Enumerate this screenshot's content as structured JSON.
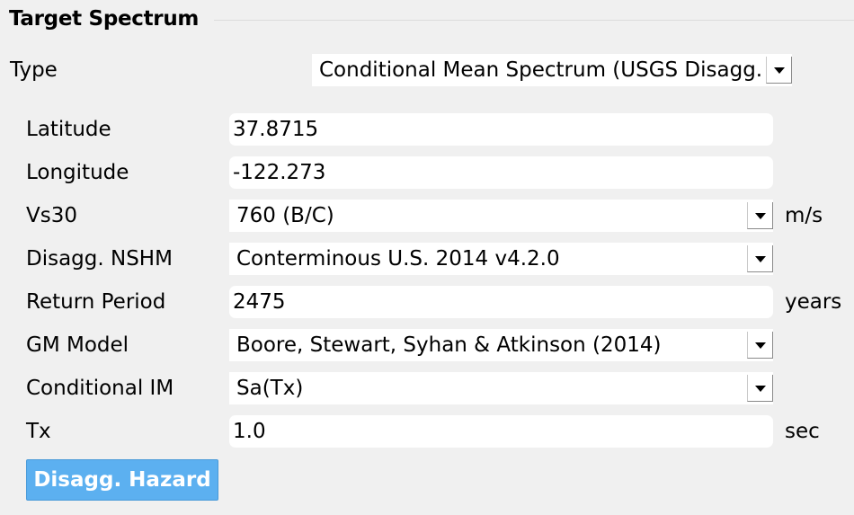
{
  "section": {
    "title": "Target Spectrum"
  },
  "type": {
    "label": "Type",
    "value": "Conditional Mean Spectrum (USGS Disagg."
  },
  "latitude": {
    "label": "Latitude",
    "value": "37.8715"
  },
  "longitude": {
    "label": "Longitude",
    "value": "-122.273"
  },
  "vs30": {
    "label": "Vs30",
    "value": "760 (B/C)",
    "unit": "m/s"
  },
  "nshm": {
    "label": "Disagg. NSHM",
    "value": "Conterminous U.S. 2014 v4.2.0"
  },
  "return_period": {
    "label": "Return Period",
    "value": "2475",
    "unit": "years"
  },
  "gm_model": {
    "label": "GM Model",
    "value": "Boore, Stewart, Syhan & Atkinson (2014)"
  },
  "conditional_im": {
    "label": "Conditional IM",
    "value": "Sa(Tx)"
  },
  "tx": {
    "label": "Tx",
    "value": "1.0",
    "unit": "sec"
  },
  "actions": {
    "disagg_hazard_label": "Disagg. Hazard"
  },
  "colors": {
    "background": "#f0f0f0",
    "field": "#ffffff",
    "button_accent": "#5cb0f0",
    "button_text": "#ffffff"
  },
  "icons": {
    "dropdown": "chevron-down-icon"
  }
}
